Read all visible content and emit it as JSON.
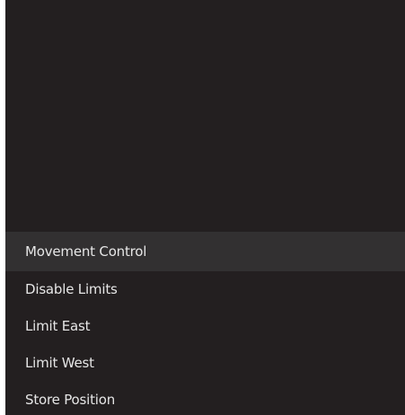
{
  "menu": {
    "items": [
      {
        "label": "Movement Control",
        "selected": true
      },
      {
        "label": "Disable Limits",
        "selected": false
      },
      {
        "label": "Limit East",
        "selected": false
      },
      {
        "label": "Limit West",
        "selected": false
      },
      {
        "label": "Store Position",
        "selected": false
      }
    ]
  },
  "colors": {
    "panel_background": "#231f20",
    "selected_background": "#323031",
    "text": "#e6e6e6"
  }
}
